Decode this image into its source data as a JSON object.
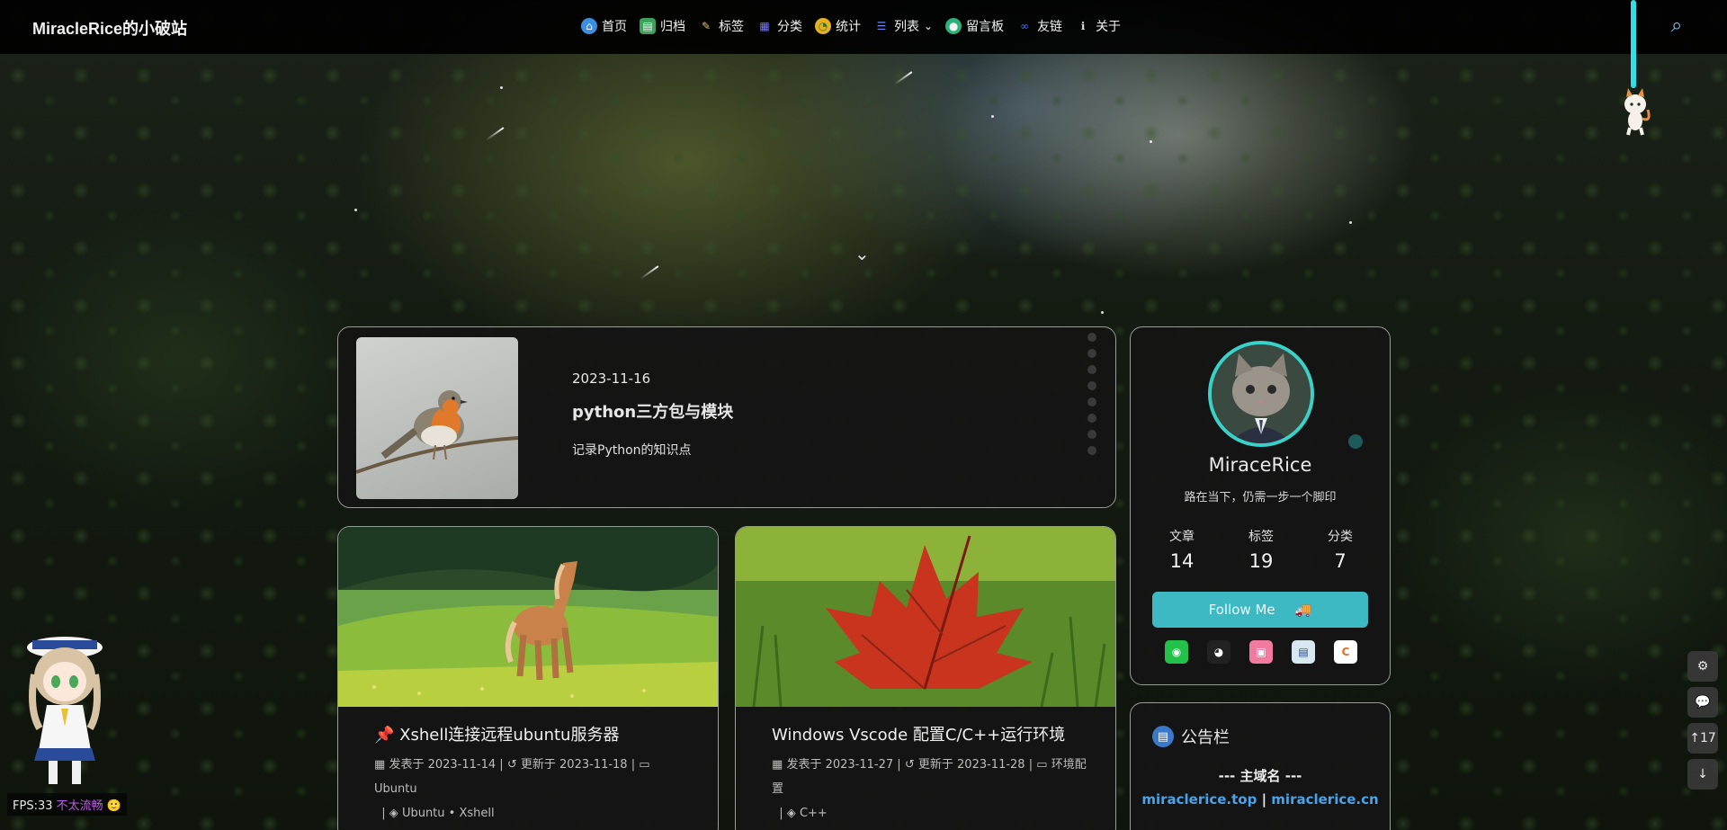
{
  "header": {
    "site_title": "MiracleRice的小破站",
    "nav": [
      {
        "label": "首页",
        "icon": "home-icon"
      },
      {
        "label": "归档",
        "icon": "archive-icon"
      },
      {
        "label": "标签",
        "icon": "tag-icon"
      },
      {
        "label": "分类",
        "icon": "category-icon"
      },
      {
        "label": "统计",
        "icon": "chart-icon"
      },
      {
        "label": "列表",
        "icon": "list-icon"
      },
      {
        "label": "留言板",
        "icon": "message-board-icon"
      },
      {
        "label": "友链",
        "icon": "link-icon"
      },
      {
        "label": "关于",
        "icon": "info-icon"
      }
    ]
  },
  "featured": {
    "date": "2023-11-16",
    "title": "python三方包与模块",
    "description": "记录Python的知识点"
  },
  "posts": [
    {
      "pinned": true,
      "title": "Xshell连接远程ubuntu服务器",
      "published_label": "发表于",
      "published": "2023-11-14",
      "updated_label": "更新于",
      "updated": "2023-11-18",
      "category": "Ubuntu",
      "tags": "Ubuntu • Xshell"
    },
    {
      "pinned": false,
      "title": "Windows Vscode 配置C/C++运行环境",
      "published_label": "发表于",
      "published": "2023-11-27",
      "updated_label": "更新于",
      "updated": "2023-11-28",
      "category": "环境配置",
      "tags": "C++"
    }
  ],
  "profile": {
    "name": "MiraceRice",
    "motto": "路在当下，仍需一步一个脚印",
    "stats": [
      {
        "label": "文章",
        "value": "14"
      },
      {
        "label": "标签",
        "value": "19"
      },
      {
        "label": "分类",
        "value": "7"
      }
    ],
    "follow_label": "Follow Me",
    "socials": [
      "wechat-icon",
      "qq-icon",
      "bilibili-icon",
      "blog-icon",
      "csdn-icon"
    ]
  },
  "notice": {
    "title": "公告栏",
    "line1": "--- 主域名 ---",
    "domain1": "miraclerice.top",
    "separator": "|",
    "domain2": "miraclerice.cn"
  },
  "tools": {
    "progress": "17"
  },
  "fps": {
    "label": "FPS:33",
    "status": "不太流畅"
  },
  "colors": {
    "accent": "#3cb9c3",
    "link": "#4aa3e8",
    "hang_line": "#2fe0e8"
  }
}
